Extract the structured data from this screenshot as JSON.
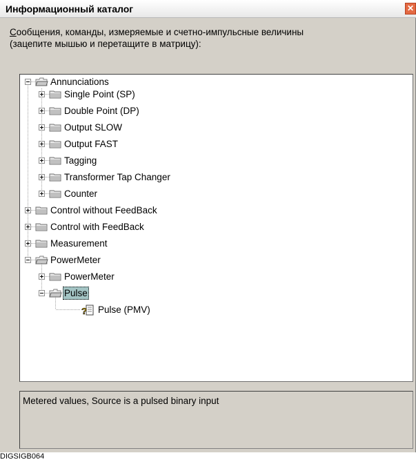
{
  "window": {
    "title": "Информационный каталог",
    "close_glyph": "✕"
  },
  "description": {
    "line1_first": "С",
    "line1_rest": "ообщения, команды, измеряемые и счетно-импульсные величины",
    "line2": "(зацепите мышью и перетащите в матрицу):"
  },
  "tree": {
    "items": [
      {
        "label": "Annunciations",
        "expanded": true,
        "icon": "folder-open-icon"
      },
      {
        "label": "Single Point (SP)",
        "expanded": false,
        "icon": "folder-icon"
      },
      {
        "label": "Double Point (DP)",
        "expanded": false,
        "icon": "folder-icon"
      },
      {
        "label": "Output SLOW",
        "expanded": false,
        "icon": "folder-icon"
      },
      {
        "label": "Output FAST",
        "expanded": false,
        "icon": "folder-icon"
      },
      {
        "label": "Tagging",
        "expanded": false,
        "icon": "folder-icon"
      },
      {
        "label": "Transformer Tap Changer",
        "expanded": false,
        "icon": "folder-icon"
      },
      {
        "label": "Counter",
        "expanded": false,
        "icon": "folder-icon"
      },
      {
        "label": "Control without FeedBack",
        "expanded": false,
        "icon": "folder-icon"
      },
      {
        "label": "Control with FeedBack",
        "expanded": false,
        "icon": "folder-icon"
      },
      {
        "label": "Measurement",
        "expanded": false,
        "icon": "folder-icon"
      },
      {
        "label": "PowerMeter",
        "expanded": true,
        "icon": "folder-open-icon"
      },
      {
        "label": "PowerMeter",
        "expanded": false,
        "icon": "folder-icon"
      },
      {
        "label": "Pulse",
        "expanded": true,
        "selected": true,
        "icon": "folder-open-icon"
      },
      {
        "label": "Pulse (PMV)",
        "icon": "pulse-value-icon"
      }
    ]
  },
  "status": {
    "text": "Metered values, Source is a pulsed binary input"
  },
  "footer": {
    "code": "DIGSIGB064"
  }
}
